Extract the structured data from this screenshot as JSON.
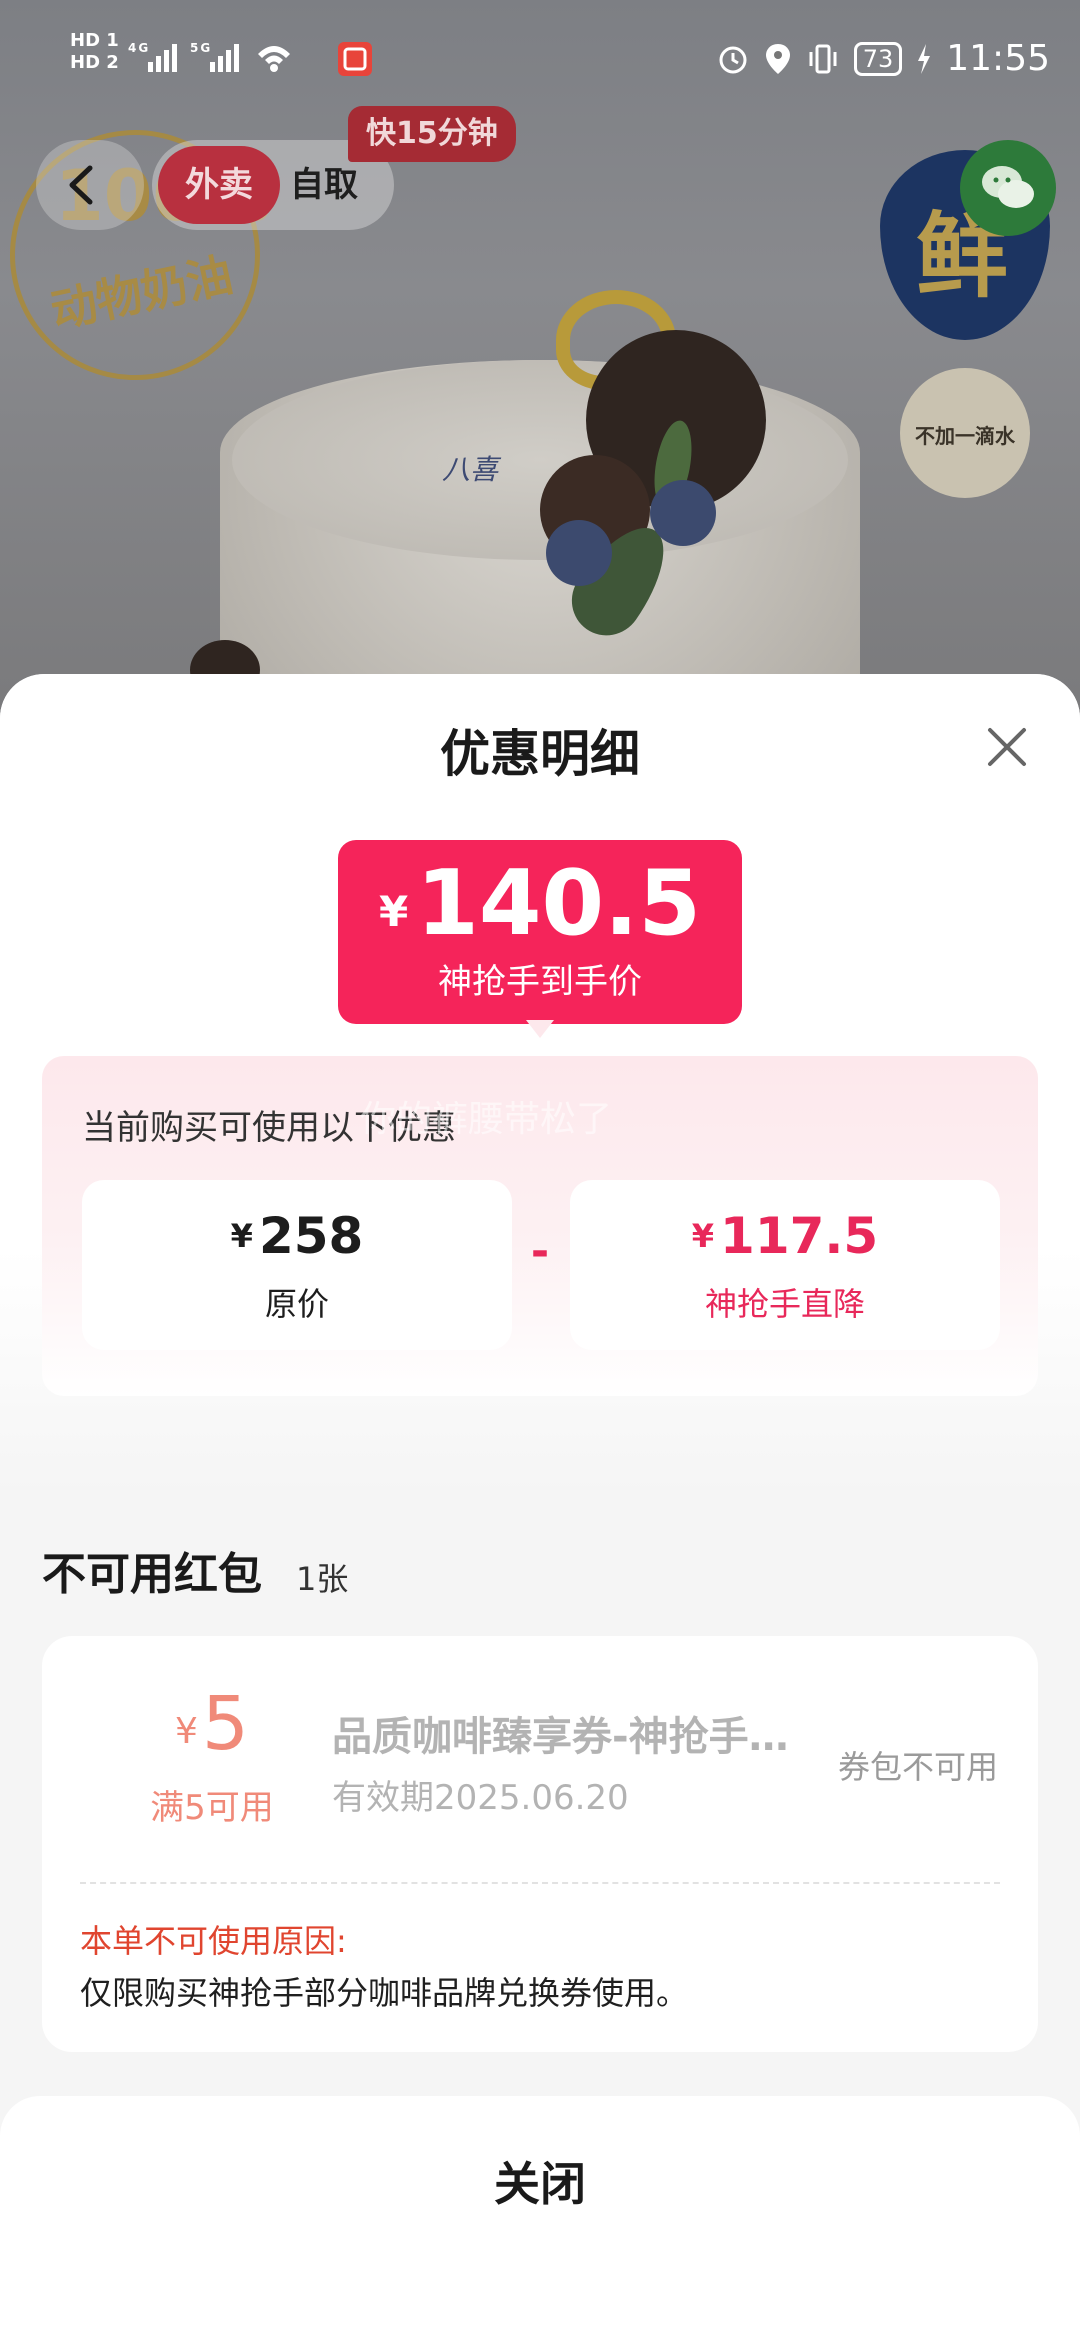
{
  "status_bar": {
    "network_top": "HD 1",
    "network_bottom": "HD 2",
    "signal": "4G 5G",
    "battery": "73",
    "time": "11:55"
  },
  "nav": {
    "mode_delivery": "外卖",
    "mode_pickup": "自取",
    "fast_tag": "快15分钟"
  },
  "hero": {
    "cream_badge_top": "100%",
    "cream_badge_text": "动物奶油",
    "fresh_badge_char": "鲜",
    "water_badge_text": "不加一滴水",
    "cake_brand": "八喜"
  },
  "sheet": {
    "title": "优惠明细",
    "final_price": {
      "currency": "¥",
      "amount": "140.5",
      "label": "神抢手到手价"
    },
    "promo_section": {
      "title": "当前购买可使用以下优惠",
      "original": {
        "currency": "¥",
        "amount": "258",
        "label": "原价"
      },
      "operator": "-",
      "discount": {
        "currency": "¥",
        "amount": "117.5",
        "label": "神抢手直降"
      }
    },
    "unusable": {
      "title": "不可用红包",
      "count": "1张",
      "coupon": {
        "currency": "¥",
        "amount": "5",
        "condition": "满5可用",
        "name": "品质咖啡臻享券-神抢手部分咖啡品牌兑换券",
        "expiry": "有效期2025.06.20",
        "status": "券包不可用",
        "reason_title": "本单不可使用原因:",
        "reason": "仅限购买神抢手部分咖啡品牌兑换券使用。"
      }
    },
    "watermark": "你的裤腰带松了",
    "close_label": "关闭"
  },
  "colors": {
    "accent": "#f5245a",
    "discount_text": "#e8285a",
    "coupon_amount": "#f08a79",
    "reason_title": "#e0452f"
  }
}
